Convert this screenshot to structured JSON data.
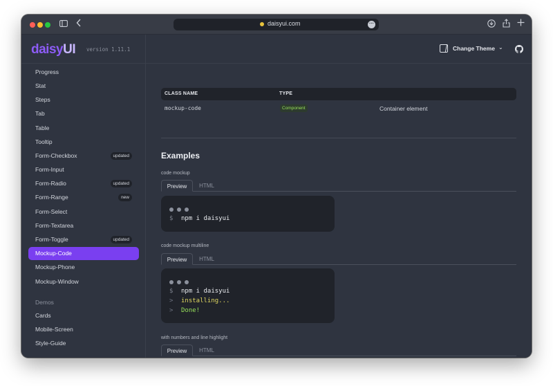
{
  "browser": {
    "url": "daisyui.com"
  },
  "sidebar": {
    "brand_part1": "daisy",
    "brand_part2": "UI",
    "version": "version 1.11.1",
    "items": [
      {
        "label": "Progress",
        "badge": ""
      },
      {
        "label": "Stat",
        "badge": ""
      },
      {
        "label": "Steps",
        "badge": ""
      },
      {
        "label": "Tab",
        "badge": ""
      },
      {
        "label": "Table",
        "badge": ""
      },
      {
        "label": "Tooltip",
        "badge": ""
      },
      {
        "label": "Form-Checkbox",
        "badge": "updated"
      },
      {
        "label": "Form-Input",
        "badge": ""
      },
      {
        "label": "Form-Radio",
        "badge": "updated"
      },
      {
        "label": "Form-Range",
        "badge": "new"
      },
      {
        "label": "Form-Select",
        "badge": ""
      },
      {
        "label": "Form-Textarea",
        "badge": ""
      },
      {
        "label": "Form-Toggle",
        "badge": "updated"
      },
      {
        "label": "Mockup-Code",
        "badge": "",
        "active": true
      },
      {
        "label": "Mockup-Phone",
        "badge": ""
      },
      {
        "label": "Mockup-Window",
        "badge": ""
      }
    ],
    "demos_heading": "Demos",
    "demo_items": [
      {
        "label": "Cards"
      },
      {
        "label": "Mobile-Screen"
      },
      {
        "label": "Style-Guide"
      }
    ]
  },
  "header": {
    "theme_label": "Change Theme",
    "theme_chevron": "⌄"
  },
  "table": {
    "columns": [
      "CLASS NAME",
      "TYPE"
    ],
    "row": {
      "class_name": "mockup-code",
      "type": "Component",
      "description": "Container element"
    }
  },
  "examples": {
    "heading": "Examples",
    "blocks": [
      {
        "label": "code mockup",
        "tabs": [
          "Preview",
          "HTML"
        ],
        "lines": [
          {
            "prefix": "$",
            "text": "npm i daisyui",
            "style": "normal"
          }
        ]
      },
      {
        "label": "code mockup multiline",
        "tabs": [
          "Preview",
          "HTML"
        ],
        "lines": [
          {
            "prefix": "$",
            "text": "npm i daisyui",
            "style": "normal"
          },
          {
            "prefix": ">",
            "text": "installing...",
            "style": "warn"
          },
          {
            "prefix": ">",
            "text": "Done!",
            "style": "ok"
          }
        ]
      },
      {
        "label": "with numbers and line highlight",
        "tabs": [
          "Preview",
          "HTML"
        ],
        "lines": []
      }
    ]
  },
  "colors": {
    "accent": "#7a3ff0",
    "background": "#2f3440",
    "code_bg": "#20232a",
    "warning_text": "#e0d760",
    "success_text": "#97e05a"
  }
}
